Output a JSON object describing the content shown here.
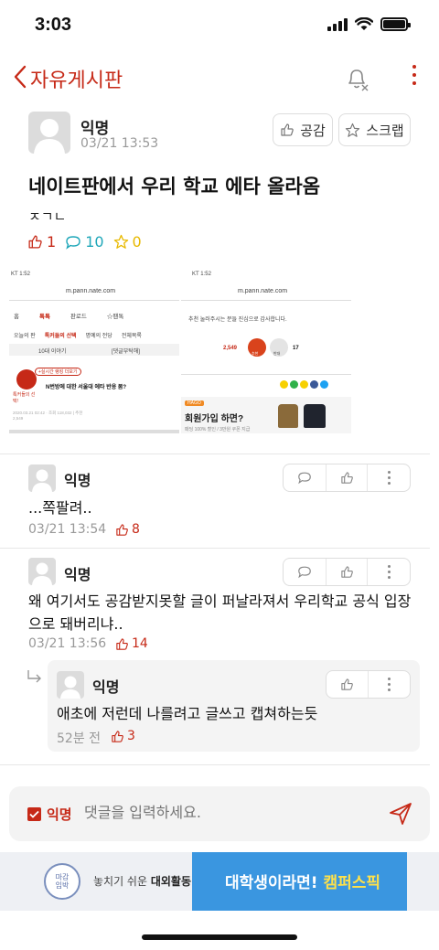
{
  "status_bar": {
    "time": "3:03"
  },
  "header": {
    "title": "자유게시판"
  },
  "post": {
    "author": "익명",
    "date": "03/21 13:53",
    "like_button": "공감",
    "scrap_button": "스크랩",
    "title": "네이트판에서 우리 학교 에타 올라옴",
    "body": "ㅈㄱㄴ",
    "stats": {
      "likes": "1",
      "comments": "10",
      "scraps": "0"
    },
    "image": {
      "left": {
        "status": "KT 1:52",
        "url": "m.pann.nate.com",
        "tabs": [
          "홈",
          "톡톡",
          "판로드",
          "☆팬톡"
        ],
        "subtabs": [
          "오늘의 판",
          "톡커들의 선택",
          "명예의 전당",
          "전체목록"
        ],
        "tab_small": [
          "10대 이야기",
          "[댓글부탁해]"
        ],
        "badge": "+실시간 랭킹 더보기",
        "headline": "N번방에 대한 서울대 에타 반응 봄?",
        "label": "톡커들의 선택!",
        "meta": "2020.03.21 02:42 · 조회 118,032 | 추천 2,549"
      },
      "right": {
        "status": "KT 1:52",
        "url": "m.pann.nate.com",
        "thanks": "추천 눌러주시는 분들 진심으로 감사합니다.",
        "up_count": "2,549",
        "down_count": "17",
        "up_label": "추천",
        "down_label": "반대",
        "ad_brand": "HAGO",
        "ad_text": "회원가입 하면?",
        "ad_sub": "패딩 100% 할인 / 3만원 쿠폰 지급"
      }
    }
  },
  "comments": [
    {
      "author": "익명",
      "text": "...쪽팔려..",
      "date": "03/21 13:54",
      "likes": "8"
    },
    {
      "author": "익명",
      "text": "왜 여기서도 공감받지못할 글이 퍼날라져서 우리학교 공식 입장으로 돼버리냐..",
      "date": "03/21 13:56",
      "likes": "14"
    }
  ],
  "reply": {
    "author": "익명",
    "text": "애초에 저런데 나를려고 글쓰고 캡쳐하는듯",
    "date": "52분 전",
    "likes": "3"
  },
  "comment_bar": {
    "anon_label": "익명",
    "placeholder": "댓글을 입력하세요."
  },
  "ad": {
    "logo_text": "마감임박",
    "left_text_1": "놓치기 쉬운",
    "left_text_2": "대외활동",
    "right_text_1": "대학생이라면!",
    "right_text_2": "캠퍼스픽"
  },
  "colors": {
    "accent": "#c62917",
    "blue": "#3a96e0"
  }
}
